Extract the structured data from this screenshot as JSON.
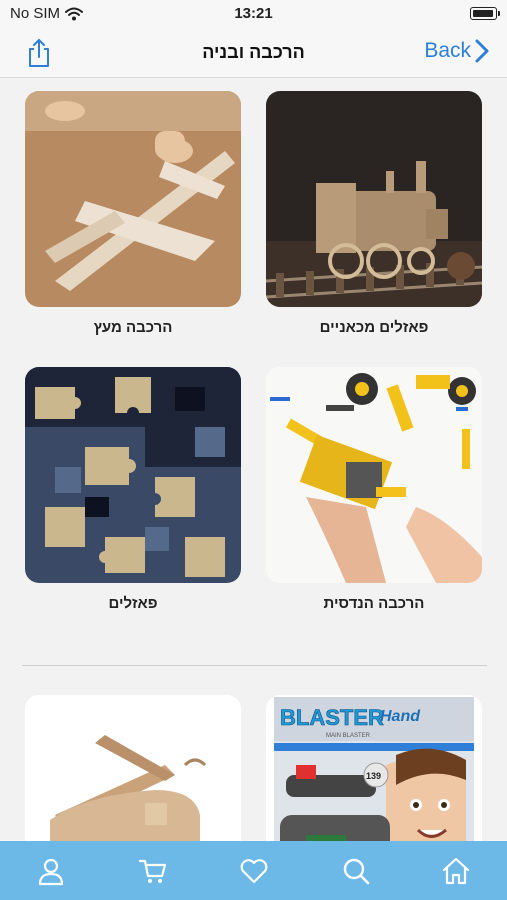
{
  "status_bar": {
    "carrier": "No SIM",
    "time": "13:21"
  },
  "nav": {
    "title": "הרכבה ובניה",
    "back_label": "Back"
  },
  "categories": [
    {
      "label": "פאזלים מכאניים",
      "image": "wooden-train-model"
    },
    {
      "label": "הרכבה מעץ",
      "image": "balsa-wood-airplane"
    },
    {
      "label": "הרכבה הנדסית",
      "image": "engineering-building-kit"
    },
    {
      "label": "פאזלים",
      "image": "jigsaw-puzzle-pieces"
    }
  ],
  "products": [
    {
      "image": "blaster-hand-box",
      "box_title": "BLASTER",
      "box_subtitle": "Hand",
      "box_tagline": "MAIN BLASTER",
      "box_count": "139"
    },
    {
      "image": "wooden-piano-model"
    }
  ],
  "tab_bar": {
    "items": [
      "home-icon",
      "search-icon",
      "heart-icon",
      "cart-icon",
      "user-icon"
    ]
  },
  "colors": {
    "accent": "#2f7fd8",
    "tab_bar": "#6cb8e6",
    "background": "#f2f2f2"
  }
}
